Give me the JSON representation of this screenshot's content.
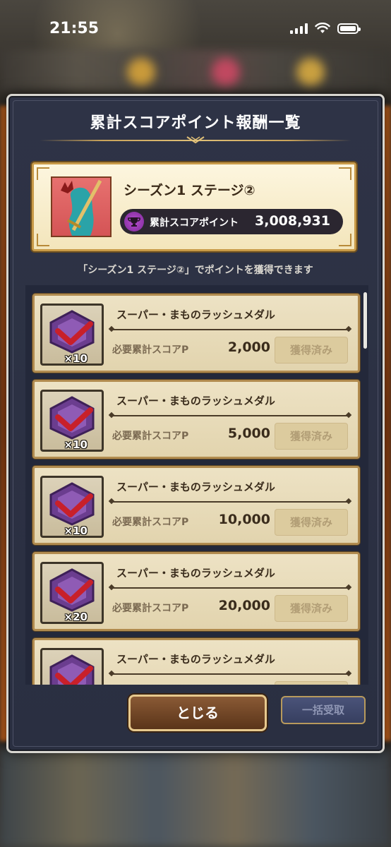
{
  "status_bar": {
    "time": "21:55"
  },
  "modal": {
    "title": "累計スコアポイント報酬一覧",
    "season": {
      "name": "シーズン1 ステージ②",
      "score_label": "累計スコアポイント",
      "score_value": "3,008,931"
    },
    "hint": "「シーズン1 ステージ②」でポイントを獲得できます",
    "rewards": [
      {
        "name": "スーパー・まものラッシュメダル",
        "quantity": "×10",
        "required_label": "必要累計スコアP",
        "required_value": "2,000",
        "status": "獲得済み"
      },
      {
        "name": "スーパー・まものラッシュメダル",
        "quantity": "×10",
        "required_label": "必要累計スコアP",
        "required_value": "5,000",
        "status": "獲得済み"
      },
      {
        "name": "スーパー・まものラッシュメダル",
        "quantity": "×10",
        "required_label": "必要累計スコアP",
        "required_value": "10,000",
        "status": "獲得済み"
      },
      {
        "name": "スーパー・まものラッシュメダル",
        "quantity": "×20",
        "required_label": "必要累計スコアP",
        "required_value": "20,000",
        "status": "獲得済み"
      },
      {
        "name": "スーパー・まものラッシュメダル",
        "quantity": "",
        "required_label": "",
        "required_value": "",
        "status": ""
      }
    ],
    "close_label": "とじる",
    "bulk_label": "一括受取"
  },
  "colors": {
    "modal_bg": "#2a2f41",
    "card_gold": "#c89a48",
    "medal_purple": "#6b3d8f",
    "check_red": "#c8202a"
  },
  "icons": {
    "score": "trophy-icon",
    "medal": "medal-icon",
    "check": "check-icon"
  }
}
